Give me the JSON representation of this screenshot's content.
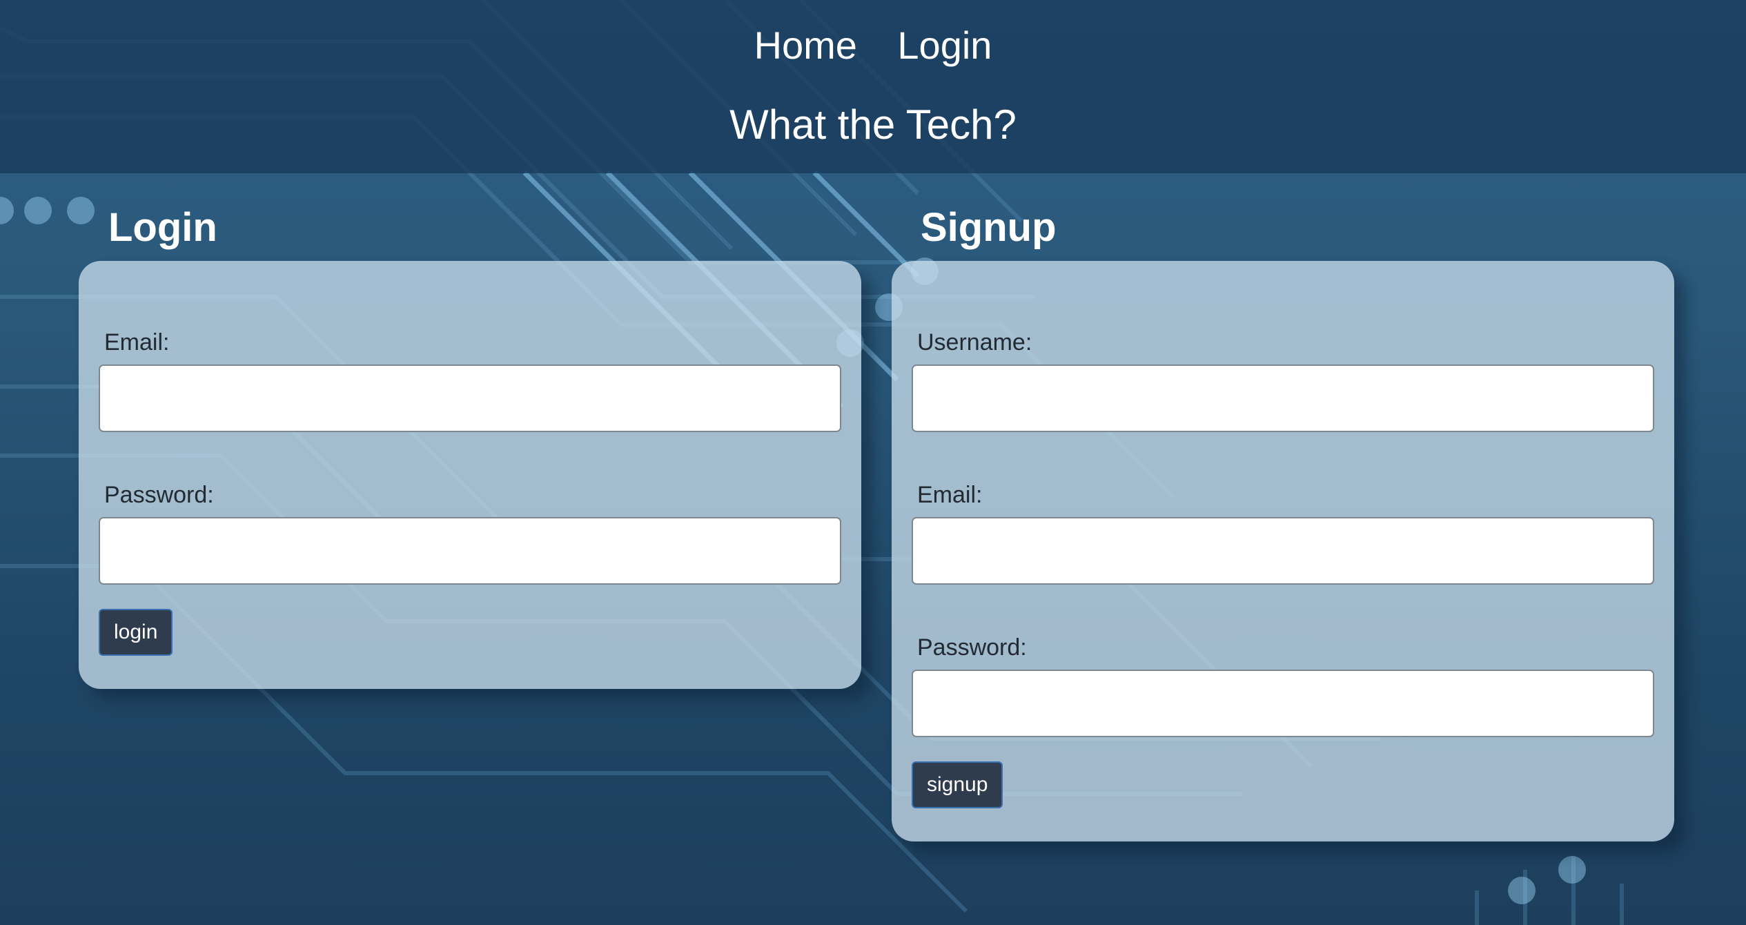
{
  "nav": {
    "home_label": "Home",
    "login_label": "Login"
  },
  "site": {
    "title": "What the Tech?"
  },
  "login": {
    "heading": "Login",
    "email_label": "Email:",
    "email_value": "",
    "password_label": "Password:",
    "password_value": "",
    "submit_label": "login"
  },
  "signup": {
    "heading": "Signup",
    "username_label": "Username:",
    "username_value": "",
    "email_label": "Email:",
    "email_value": "",
    "password_label": "Password:",
    "password_value": "",
    "submit_label": "signup"
  },
  "colors": {
    "header_bg": "#183a5a",
    "card_bg": "#c6dbe9",
    "button_bg": "#2f3c4d",
    "button_border": "#3a6fb0",
    "text_light": "#ffffff"
  }
}
